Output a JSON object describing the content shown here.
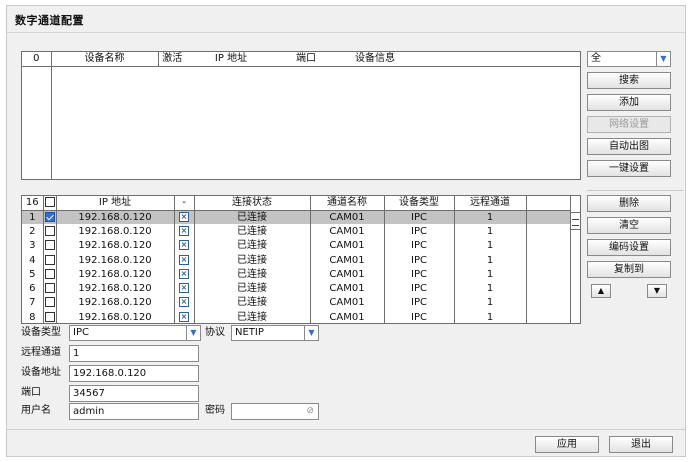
{
  "window": {
    "title": "数字通道配置"
  },
  "search_table": {
    "count": "0",
    "columns": [
      "设备名称",
      "激活",
      "IP 地址",
      "端口",
      "设备信息"
    ]
  },
  "filter": {
    "value": "全"
  },
  "right_buttons_top": [
    "搜索",
    "添加",
    "网络设置",
    "自动出图",
    "一键设置"
  ],
  "device_table": {
    "count": "16",
    "columns": [
      "IP 地址",
      "-",
      "连接状态",
      "通道名称",
      "设备类型",
      "远程通道"
    ],
    "rows": [
      {
        "no": "1",
        "ip": "192.168.0.120",
        "status": "已连接",
        "name": "CAM01",
        "type": "IPC",
        "remote": "1",
        "checked": true
      },
      {
        "no": "2",
        "ip": "192.168.0.120",
        "status": "已连接",
        "name": "CAM01",
        "type": "IPC",
        "remote": "1",
        "checked": false
      },
      {
        "no": "3",
        "ip": "192.168.0.120",
        "status": "已连接",
        "name": "CAM01",
        "type": "IPC",
        "remote": "1",
        "checked": false
      },
      {
        "no": "4",
        "ip": "192.168.0.120",
        "status": "已连接",
        "name": "CAM01",
        "type": "IPC",
        "remote": "1",
        "checked": false
      },
      {
        "no": "5",
        "ip": "192.168.0.120",
        "status": "已连接",
        "name": "CAM01",
        "type": "IPC",
        "remote": "1",
        "checked": false
      },
      {
        "no": "6",
        "ip": "192.168.0.120",
        "status": "已连接",
        "name": "CAM01",
        "type": "IPC",
        "remote": "1",
        "checked": false
      },
      {
        "no": "7",
        "ip": "192.168.0.120",
        "status": "已连接",
        "name": "CAM01",
        "type": "IPC",
        "remote": "1",
        "checked": false
      },
      {
        "no": "8",
        "ip": "192.168.0.120",
        "status": "已连接",
        "name": "CAM01",
        "type": "IPC",
        "remote": "1",
        "checked": false
      }
    ]
  },
  "right_buttons_bottom": [
    "删除",
    "清空",
    "编码设置",
    "复制到"
  ],
  "arrows": {
    "up": "▲",
    "down": "▼"
  },
  "form": {
    "device_type_label": "设备类型",
    "device_type_value": "IPC",
    "protocol_label": "协议",
    "protocol_value": "NETIP",
    "remote_channel_label": "远程通道",
    "remote_channel_value": "1",
    "address_label": "设备地址",
    "address_value": "192.168.0.120",
    "port_label": "端口",
    "port_value": "34567",
    "username_label": "用户名",
    "username_value": "admin",
    "password_label": "密码",
    "password_value": ""
  },
  "footer": {
    "apply": "应用",
    "exit": "退出"
  },
  "colors": {
    "selected_row": "#c3c3c3",
    "check_blue": "#2d6fd6",
    "arrow_blue": "#3470c8"
  }
}
